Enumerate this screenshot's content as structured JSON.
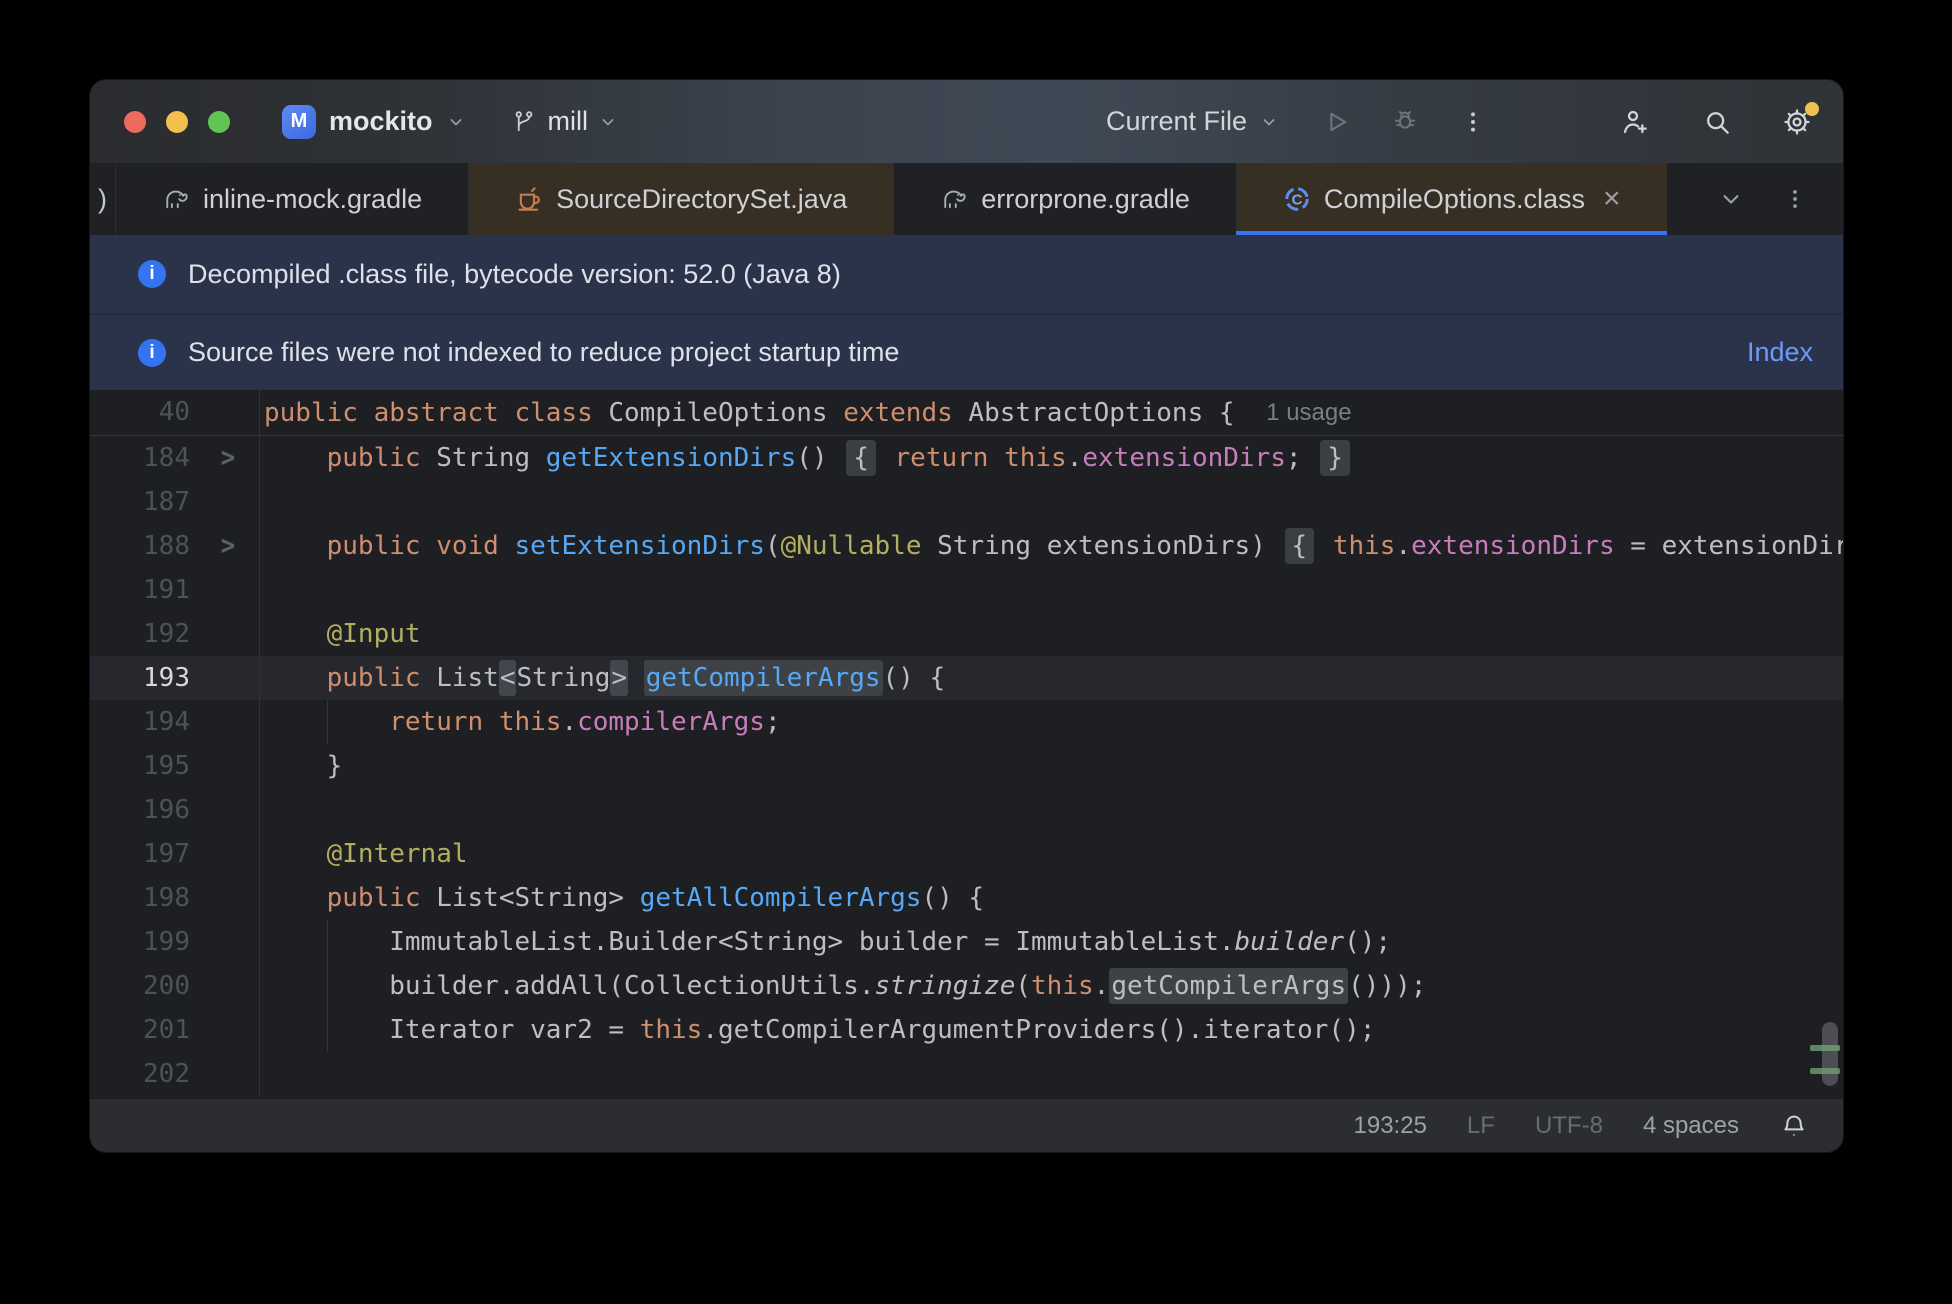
{
  "colors": {
    "accent_blue": "#3574f0",
    "banner_bg": "#2a3349",
    "link_blue": "#6b9bfa",
    "editor_bg": "#1e1f22",
    "library_tab_tint": "#372f24",
    "keyword_orange": "#cf8e6d",
    "method_blue": "#57a8f5",
    "field_purple": "#c77dbb",
    "annotation_yellow": "#b3ae60",
    "traffic_red": "#ec6a5e",
    "traffic_yellow": "#f4bf4f",
    "traffic_green": "#61c553",
    "settings_badge_yellow": "#edc04f",
    "scroll_mark_green": "#6f9f74"
  },
  "titlebar": {
    "project_initial": "M",
    "project": "mockito",
    "branch": "mill",
    "run_config": "Current File"
  },
  "tabs": [
    {
      "label": ")",
      "partial": true
    },
    {
      "label": "inline-mock.gradle",
      "icon": "gradle"
    },
    {
      "label": "SourceDirectorySet.java",
      "icon": "java",
      "tinted": true
    },
    {
      "label": "errorprone.gradle",
      "icon": "gradle"
    },
    {
      "label": "CompileOptions.class",
      "icon": "class",
      "tinted": true,
      "active": true,
      "closable": true
    }
  ],
  "banners": [
    {
      "text": "Decompiled .class file, bytecode version: 52.0 (Java 8)"
    },
    {
      "text": "Source files were not indexed to reduce project startup time",
      "action": "Index"
    }
  ],
  "editor": {
    "sticky": {
      "num": "40",
      "usage_label": "1 usage",
      "tokens": [
        {
          "s": "public abstract class ",
          "c": "kw"
        },
        {
          "s": "CompileOptions ",
          "c": "plain"
        },
        {
          "s": "extends ",
          "c": "kw"
        },
        {
          "s": "AbstractOptions { ",
          "c": "plain"
        }
      ]
    },
    "lines": [
      {
        "num": "184",
        "fold": true,
        "tokens": [
          {
            "s": "    ",
            "c": "plain"
          },
          {
            "s": "public ",
            "c": "kw"
          },
          {
            "s": "String ",
            "c": "plain"
          },
          {
            "s": "getExtensionDirs",
            "c": "meth"
          },
          {
            "s": "() ",
            "c": "plain"
          },
          {
            "s": "{",
            "c": "plain",
            "b": "fold"
          },
          {
            "s": " ",
            "c": "plain"
          },
          {
            "s": "return ",
            "c": "kw"
          },
          {
            "s": "this",
            "c": "kw"
          },
          {
            "s": ".",
            "c": "plain"
          },
          {
            "s": "extensionDirs",
            "c": "field"
          },
          {
            "s": "; ",
            "c": "plain"
          },
          {
            "s": "}",
            "c": "plain",
            "b": "fold"
          }
        ]
      },
      {
        "num": "187",
        "tokens": []
      },
      {
        "num": "188",
        "fold": true,
        "tokens": [
          {
            "s": "    ",
            "c": "plain"
          },
          {
            "s": "public ",
            "c": "kw"
          },
          {
            "s": "void ",
            "c": "kw"
          },
          {
            "s": "setExtensionDirs",
            "c": "meth"
          },
          {
            "s": "(",
            "c": "plain"
          },
          {
            "s": "@Nullable",
            "c": "ann"
          },
          {
            "s": " String extensionDirs) ",
            "c": "plain"
          },
          {
            "s": "{",
            "c": "plain",
            "b": "fold"
          },
          {
            "s": " ",
            "c": "plain"
          },
          {
            "s": "this",
            "c": "kw"
          },
          {
            "s": ".",
            "c": "plain"
          },
          {
            "s": "extensionDirs",
            "c": "field"
          },
          {
            "s": " = extensionDirs;",
            "c": "plain"
          }
        ]
      },
      {
        "num": "191",
        "tokens": []
      },
      {
        "num": "192",
        "tokens": [
          {
            "s": "    ",
            "c": "plain"
          },
          {
            "s": "@Input",
            "c": "ann"
          }
        ]
      },
      {
        "num": "193",
        "current": true,
        "tokens": [
          {
            "s": "    ",
            "c": "plain"
          },
          {
            "s": "public ",
            "c": "kw"
          },
          {
            "s": "List",
            "c": "plain"
          },
          {
            "s": "<",
            "c": "plain",
            "b": "brace"
          },
          {
            "s": "String",
            "c": "plain"
          },
          {
            "s": ">",
            "c": "plain",
            "b": "brace"
          },
          {
            "s": " ",
            "c": "plain"
          },
          {
            "s": "getCompilerArgs",
            "c": "meth",
            "b": "usage"
          },
          {
            "s": "() {",
            "c": "plain"
          }
        ]
      },
      {
        "num": "194",
        "guide": true,
        "tokens": [
          {
            "s": "        ",
            "c": "plain"
          },
          {
            "s": "return ",
            "c": "kw"
          },
          {
            "s": "this",
            "c": "kw"
          },
          {
            "s": ".",
            "c": "plain"
          },
          {
            "s": "compilerArgs",
            "c": "field"
          },
          {
            "s": ";",
            "c": "plain"
          }
        ]
      },
      {
        "num": "195",
        "tokens": [
          {
            "s": "    }",
            "c": "plain"
          }
        ]
      },
      {
        "num": "196",
        "tokens": []
      },
      {
        "num": "197",
        "tokens": [
          {
            "s": "    ",
            "c": "plain"
          },
          {
            "s": "@Internal",
            "c": "ann"
          }
        ]
      },
      {
        "num": "198",
        "tokens": [
          {
            "s": "    ",
            "c": "plain"
          },
          {
            "s": "public ",
            "c": "kw"
          },
          {
            "s": "List<String> ",
            "c": "plain"
          },
          {
            "s": "getAllCompilerArgs",
            "c": "meth"
          },
          {
            "s": "() {",
            "c": "plain"
          }
        ]
      },
      {
        "num": "199",
        "guide": true,
        "tokens": [
          {
            "s": "        ImmutableList.Builder<String> builder = ImmutableList.",
            "c": "plain"
          },
          {
            "s": "builder",
            "c": "it"
          },
          {
            "s": "();",
            "c": "plain"
          }
        ]
      },
      {
        "num": "200",
        "guide": true,
        "tokens": [
          {
            "s": "        builder.addAll(CollectionUtils.",
            "c": "plain"
          },
          {
            "s": "stringize",
            "c": "it"
          },
          {
            "s": "(",
            "c": "plain"
          },
          {
            "s": "this",
            "c": "kw"
          },
          {
            "s": ".",
            "c": "plain"
          },
          {
            "s": "getCompilerArgs",
            "c": "plain",
            "b": "usage"
          },
          {
            "s": "()));",
            "c": "plain"
          }
        ]
      },
      {
        "num": "201",
        "guide": true,
        "tokens": [
          {
            "s": "        Iterator var2 = ",
            "c": "plain"
          },
          {
            "s": "this",
            "c": "kw"
          },
          {
            "s": ".getCompilerArgumentProviders().iterator();",
            "c": "plain"
          }
        ]
      },
      {
        "num": "202",
        "tokens": []
      }
    ]
  },
  "status_bar": {
    "caret": "193:25",
    "line_ending": "LF",
    "encoding": "UTF-8",
    "indent": "4 spaces"
  }
}
